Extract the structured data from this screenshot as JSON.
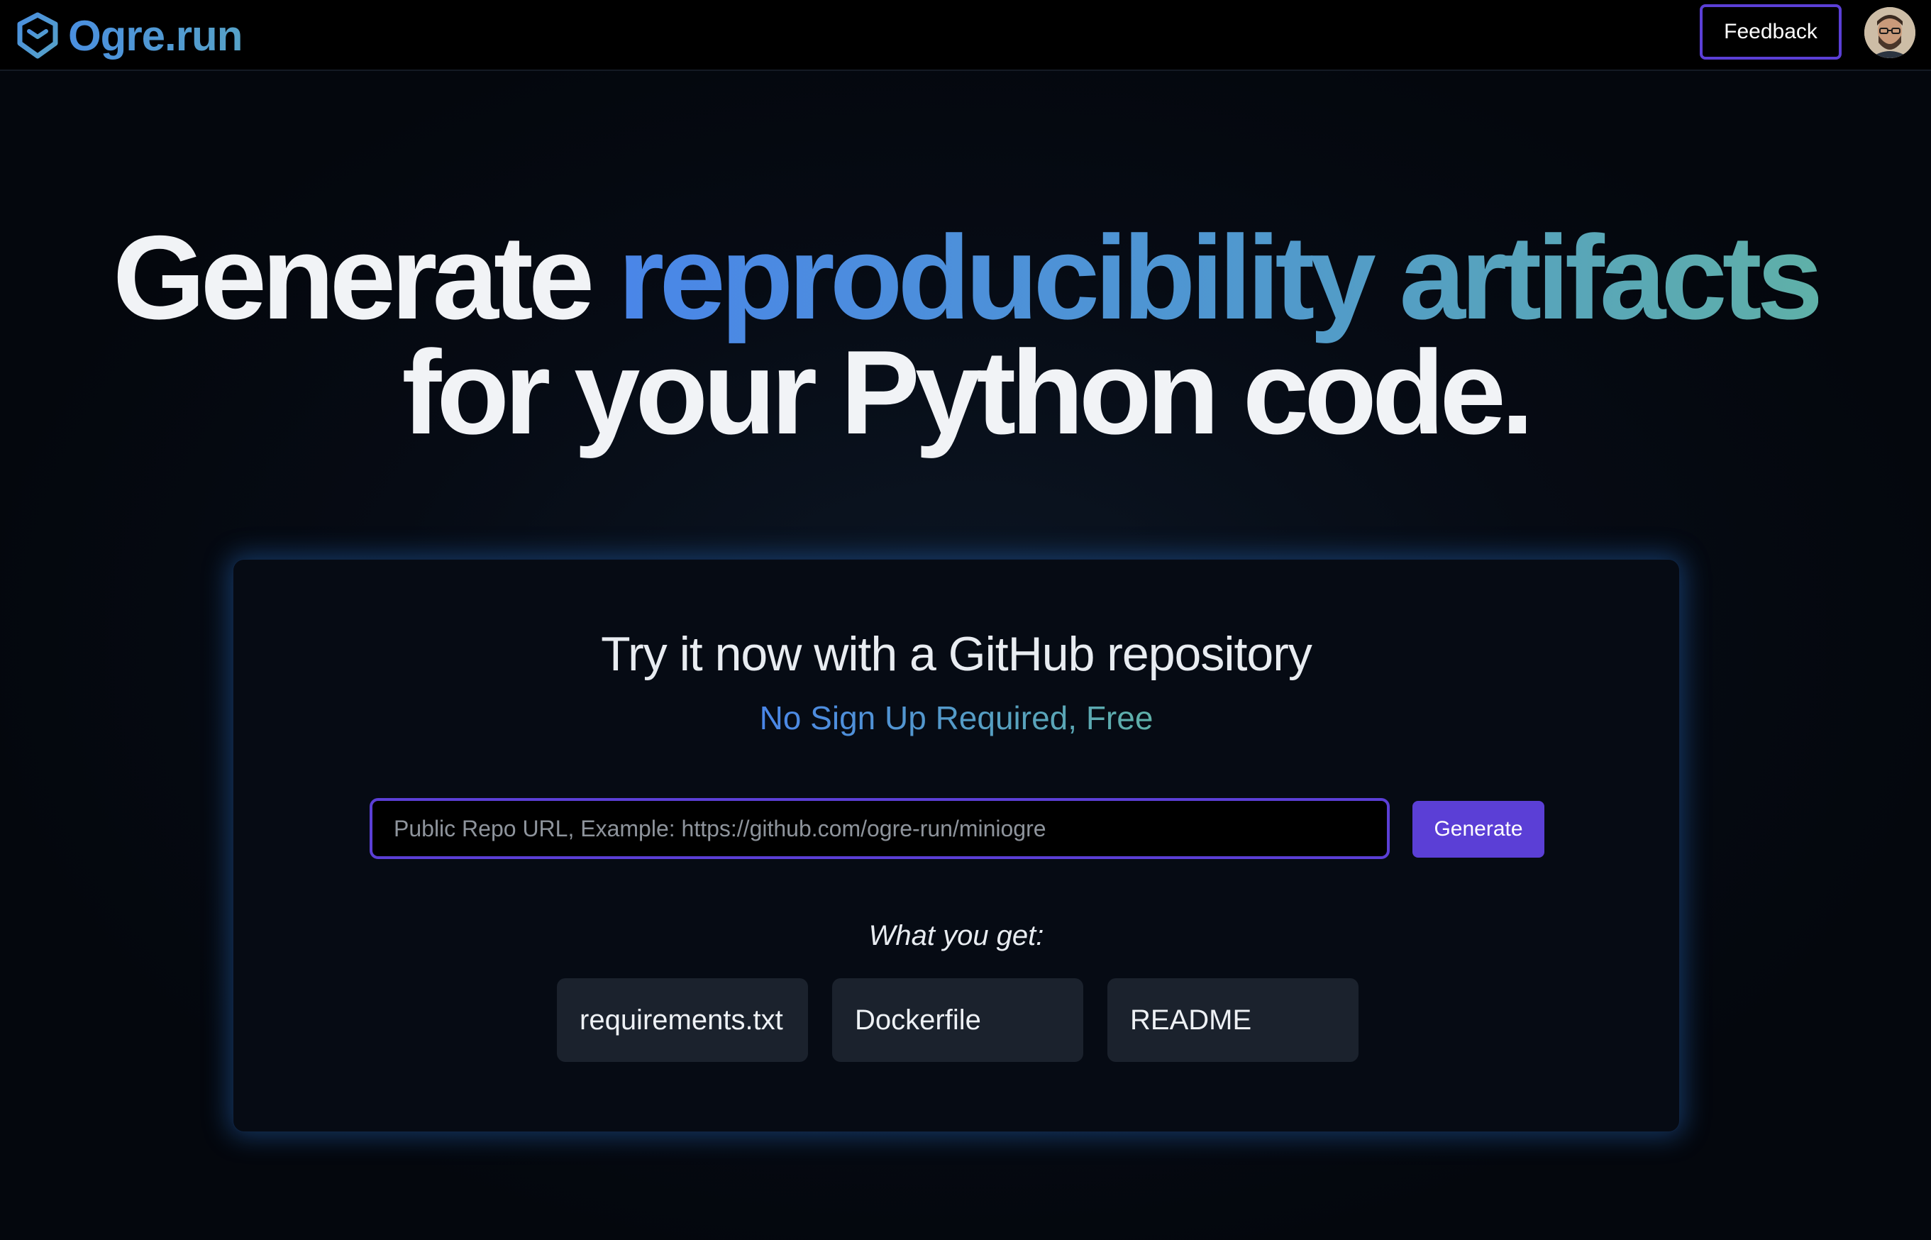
{
  "header": {
    "logo_text": "Ogre.run",
    "feedback_label": "Feedback"
  },
  "hero": {
    "line1_prefix": "Generate",
    "line1_highlight": "reproducibility artifacts",
    "line2": "for your Python code."
  },
  "card": {
    "title": "Try it now with a GitHub repository",
    "subtitle": "No Sign Up Required, Free",
    "input_placeholder": "Public Repo URL, Example: https://github.com/ogre-run/miniogre",
    "input_value": "",
    "generate_label": "Generate",
    "what_label": "What you get:",
    "artifacts": [
      "requirements.txt",
      "Dockerfile",
      "README"
    ]
  },
  "colors": {
    "accent_purple": "#5b3fd6",
    "gradient_blue": "#4a86e8",
    "gradient_teal": "#5fb0a8",
    "background": "#050a12"
  },
  "icons": {
    "logo": "hexagon-shield-icon",
    "avatar": "user-avatar"
  }
}
